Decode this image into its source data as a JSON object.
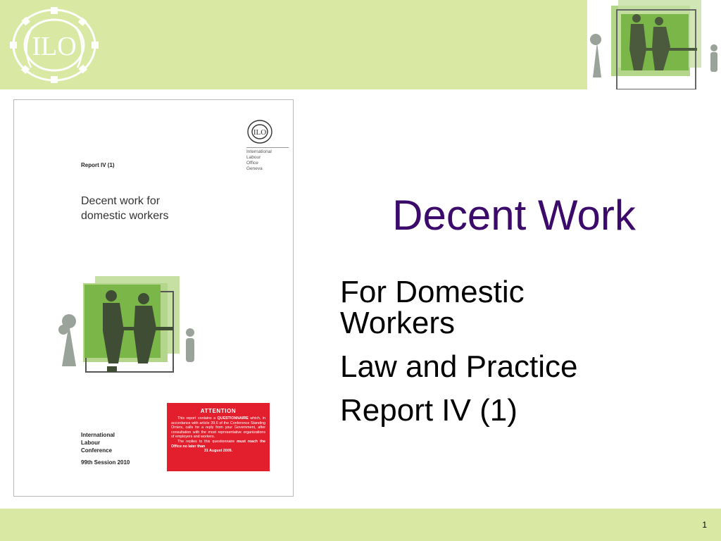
{
  "header": {
    "logo": {
      "text": "ILO",
      "icon": "ilo-gear-wreath-logo"
    },
    "photo_icon": "domestic-workers-illustration"
  },
  "colors": {
    "band": "#d9e8a3",
    "title": "#3b0a6b",
    "attention_red": "#e31e2d",
    "illustration_green": "#7ab648",
    "illustration_light_green": "#b4d68a"
  },
  "cover": {
    "report_number": "Report IV (1)",
    "title_line1": "Decent work for",
    "title_line2": "domestic workers",
    "office_line1": "International",
    "office_line2": "Labour",
    "office_line3": "Office",
    "office_line4": "Geneva",
    "conference_line1": "International",
    "conference_line2": "Labour",
    "conference_line3": "Conference",
    "session": "99th Session 2010",
    "attention": {
      "heading": "ATTENTION",
      "body_pre": "This report contains a ",
      "body_strong": "QUESTIONNAIRE",
      "body_post": " which, in accordance with article 39.6 of the Conference Standing Orders, calls for a reply from your Government, after consultation with the most representative organizations of employers and workers.",
      "reply_pre": "The replies to this questionnaire ",
      "reply_strong": "must reach the Office no later than",
      "reply_date": "31 August 2009."
    }
  },
  "slide": {
    "title": "Decent Work",
    "bullets": [
      "For Domestic Workers",
      "Law and Practice",
      "Report IV (1)"
    ]
  },
  "footer": {
    "page_number": "1"
  }
}
